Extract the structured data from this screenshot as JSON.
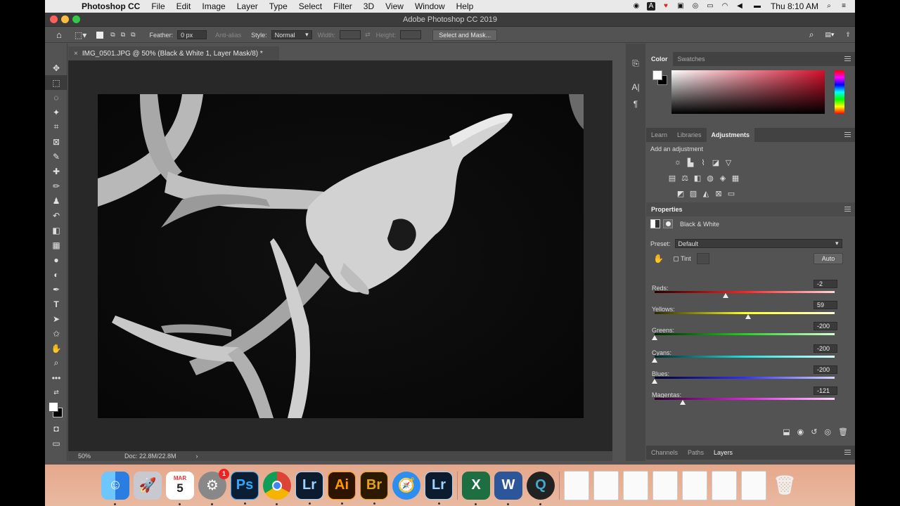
{
  "menubar": {
    "app_name": "Photoshop CC",
    "items": [
      "File",
      "Edit",
      "Image",
      "Layer",
      "Type",
      "Select",
      "Filter",
      "3D",
      "View",
      "Window",
      "Help"
    ],
    "clock": "Thu 8:10 AM"
  },
  "window": {
    "title": "Adobe Photoshop CC 2019"
  },
  "options": {
    "feather_label": "Feather:",
    "feather_value": "0 px",
    "anti_alias_label": "Anti-alias",
    "style_label": "Style:",
    "style_value": "Normal",
    "width_label": "Width:",
    "height_label": "Height:",
    "select_mask_label": "Select and Mask..."
  },
  "document": {
    "tab_title": "IMG_0501.JPG @ 50% (Black & White 1, Layer Mask/8) *",
    "zoom": "50%",
    "doc_size": "Doc: 22.8M/22.8M"
  },
  "color_panel": {
    "tabs": [
      "Color",
      "Swatches"
    ]
  },
  "adjust_panel": {
    "tabs": [
      "Learn",
      "Libraries",
      "Adjustments"
    ],
    "hint": "Add an adjustment"
  },
  "properties": {
    "title": "Properties",
    "layer_type": "Black & White",
    "preset_label": "Preset:",
    "preset_value": "Default",
    "tint_label": "Tint",
    "auto_label": "Auto",
    "sliders": [
      {
        "label": "Reds:",
        "value": "-2",
        "num": -2
      },
      {
        "label": "Yellows:",
        "value": "59",
        "num": 59
      },
      {
        "label": "Greens:",
        "value": "-200",
        "num": -200
      },
      {
        "label": "Cyans:",
        "value": "-200",
        "num": -200
      },
      {
        "label": "Blues:",
        "value": "-200",
        "num": -200
      },
      {
        "label": "Magentas:",
        "value": "-121",
        "num": -121
      }
    ]
  },
  "bottom_panel": {
    "tabs": [
      "Channels",
      "Paths",
      "Layers"
    ]
  },
  "dock": {
    "calendar_month": "MAR",
    "calendar_day": "5",
    "badge": "1",
    "apps": [
      "Ps",
      "Lr",
      "Ai",
      "Br",
      "Lr"
    ]
  }
}
